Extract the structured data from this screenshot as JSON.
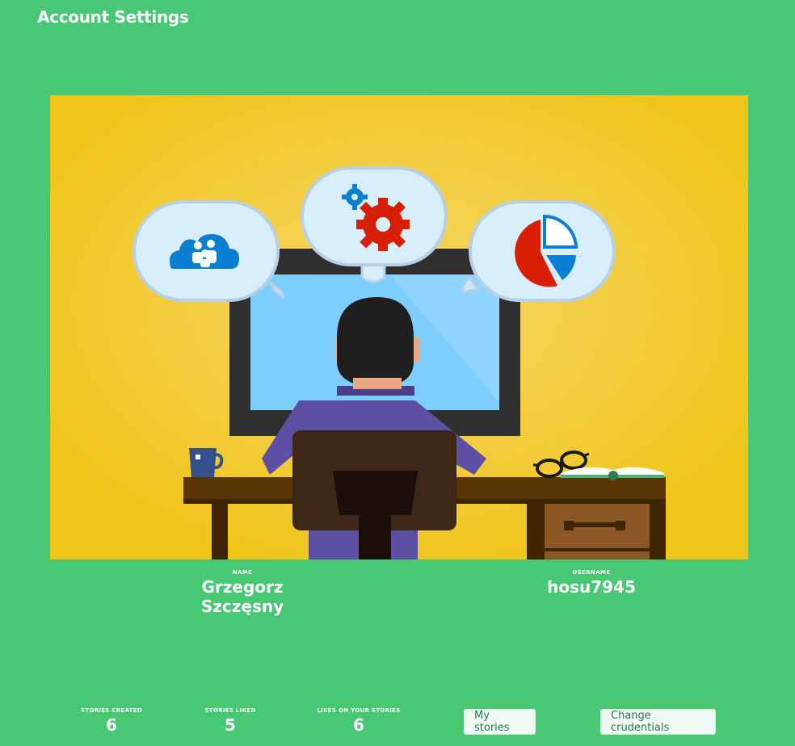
{
  "header": {
    "title": "Account Settings"
  },
  "profile": {
    "name_label": "NAME",
    "name": "Grzegorz Szczęsny",
    "username_label": "USERNAME",
    "username": "hosu7945"
  },
  "stats": {
    "stories_created_label": "STORIES CREATED",
    "stories_created": "6",
    "stories_liked_label": "STORIES LIKED",
    "stories_liked": "5",
    "likes_received_label": "LIKES ON YOUR STORIES",
    "likes_received": "6"
  },
  "actions": {
    "my_stories_label": "My stories",
    "change_credentials_label": "Change crudentials"
  },
  "colors": {
    "background": "#48c774",
    "hero_background": "#f0c419",
    "button_background": "#effaf4",
    "button_text": "#257953"
  },
  "hero": {
    "icons": [
      "cloud-users-icon",
      "gears-icon",
      "pie-chart-icon",
      "mug-icon",
      "glasses-icon",
      "book-icon"
    ]
  }
}
